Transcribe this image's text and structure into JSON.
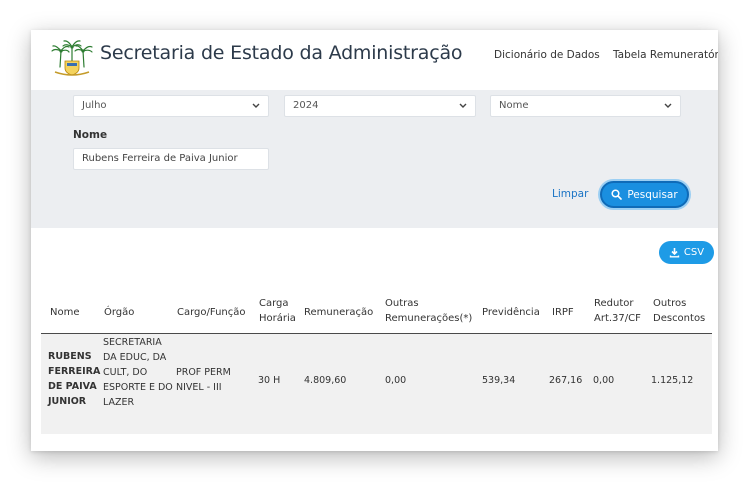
{
  "header": {
    "title": "Secretaria de Estado da Administração",
    "nav": [
      "Dicionário de Dados",
      "Tabela Remuneratória"
    ]
  },
  "filters": {
    "month": "Julho",
    "year": "2024",
    "search_by": "Nome",
    "name_label": "Nome",
    "name_value": "Rubens Ferreira de Paiva Junior",
    "clear_label": "Limpar",
    "search_label": "Pesquisar"
  },
  "export": {
    "csv_label": "CSV"
  },
  "table": {
    "columns": [
      "Nome",
      "Órgão",
      "Cargo/Função",
      "Carga Horária",
      "Remuneração",
      "Outras Remunerações(*)",
      "Previdência",
      "IRPF",
      "Redutor Art.37/CF",
      "Outros Descontos"
    ],
    "rows": [
      {
        "nome": "RUBENS FERREIRA DE PAIVA JUNIOR",
        "orgao": "SECRETARIA DA EDUC, DA CULT, DO ESPORTE E DO LAZER",
        "cargo": "PROF PERM NIVEL - III",
        "carga": "30 H",
        "remuneracao": "4.809,60",
        "outras": "0,00",
        "previdencia": "539,34",
        "irpf": "267,16",
        "redutor": "0,00",
        "descontos": "1.125,12"
      }
    ]
  },
  "colors": {
    "accent": "#1a8fe0",
    "filter_bg": "#eceef1",
    "row_bg": "#f1f1f1"
  }
}
